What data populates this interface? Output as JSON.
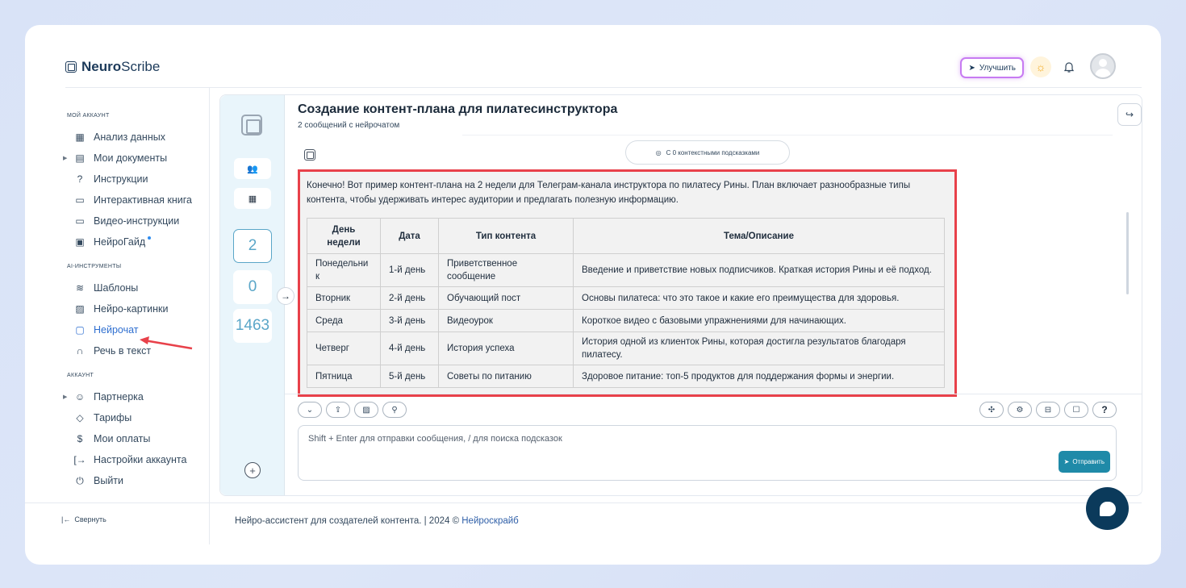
{
  "header": {
    "logo_bold": "Neuro",
    "logo_light": "Scribe",
    "upgrade_label": "Улучшить"
  },
  "sidebar": {
    "sections": [
      {
        "title": "МОЙ АККАУНТ",
        "items": [
          {
            "label": "Анализ данных",
            "icon": "grid-icon"
          },
          {
            "label": "Мои документы",
            "icon": "document-icon",
            "caret": true
          },
          {
            "label": "Инструкции",
            "icon": "help-circle-icon"
          },
          {
            "label": "Интерактивная книга",
            "icon": "book-icon"
          },
          {
            "label": "Видео-инструкции",
            "icon": "video-icon"
          },
          {
            "label": "НейроГайд",
            "icon": "guide-icon",
            "dot": true
          }
        ]
      },
      {
        "title": "AI-ИНСТРУМЕНТЫ",
        "items": [
          {
            "label": "Шаблоны",
            "icon": "layers-icon"
          },
          {
            "label": "Нейро-картинки",
            "icon": "image-icon"
          },
          {
            "label": "Нейрочат",
            "icon": "chat-icon",
            "active": true
          },
          {
            "label": "Речь в текст",
            "icon": "headphones-icon"
          }
        ]
      },
      {
        "title": "АККАУНТ",
        "items": [
          {
            "label": "Партнерка",
            "icon": "users-icon",
            "caret": true
          },
          {
            "label": "Тарифы",
            "icon": "tag-icon"
          },
          {
            "label": "Мои оплаты",
            "icon": "dollar-icon"
          },
          {
            "label": "Настройки аккаунта",
            "icon": "settings-icon"
          },
          {
            "label": "Выйти",
            "icon": "power-icon"
          }
        ]
      }
    ],
    "collapse_label": "Свернуть"
  },
  "rail": {
    "counters": [
      "2",
      "0",
      "1463"
    ]
  },
  "chat": {
    "title": "Создание контент-плана для пилатесинструктора",
    "subtitle": "2 сообщений с нейрочатом",
    "hint_label": "С 0 контекстными подсказками",
    "message_intro": "Конечно! Вот пример контент-плана на 2 недели для Телеграм-канала инструктора по пилатесу Рины. План включает разнообразные типы контента, чтобы удерживать интерес аудитории и предлагать полезную информацию.",
    "table": {
      "headers": [
        "День недели",
        "Дата",
        "Тип контента",
        "Тема/Описание"
      ],
      "rows": [
        [
          "Понедельник",
          "1-й день",
          "Приветственное сообщение",
          "Введение и приветствие новых подписчиков. Краткая история Рины и её подход."
        ],
        [
          "Вторник",
          "2-й день",
          "Обучающий пост",
          "Основы пилатеса: что это такое и какие его преимущества для здоровья."
        ],
        [
          "Среда",
          "3-й день",
          "Видеоурок",
          "Короткое видео с базовыми упражнениями для начинающих."
        ],
        [
          "Четверг",
          "4-й день",
          "История успеха",
          "История одной из клиенток Рины, которая достигла результатов благодаря пилатесу."
        ],
        [
          "Пятница",
          "5-й день",
          "Советы по питанию",
          "Здоровое питание: топ-5 продуктов для поддержания формы и энергии."
        ]
      ]
    },
    "input_placeholder": "Shift + Enter для отправки сообщения, / для поиска подсказок",
    "send_label": "Отправить",
    "help_label": "?"
  },
  "footer": {
    "text": "Нейро-ассистент для создателей контента.  | 2024 © ",
    "link": "Нейроскрайб"
  },
  "colors": {
    "accent": "#1f8aa8",
    "highlight_border": "#e8414a",
    "active_nav": "#2f6fd0"
  }
}
